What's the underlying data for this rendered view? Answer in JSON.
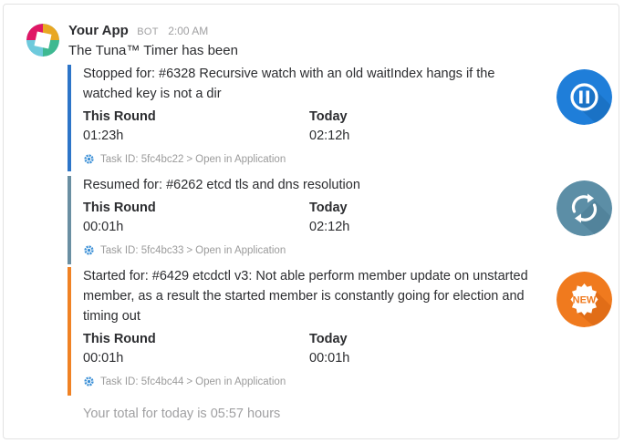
{
  "message": {
    "sender": "Your App",
    "badge": "BOT",
    "time": "2:00 AM",
    "intro": "The Tuna™ Timer has been"
  },
  "attachments": [
    {
      "text": "Stopped for: #6328 Recursive watch with an old waitIndex hangs if the watched key is not a dir",
      "color": "#2d75c8",
      "fields": [
        {
          "title": "This Round",
          "value": "01:23h"
        },
        {
          "title": "Today",
          "value": "02:12h"
        }
      ],
      "footer_task": "Task ID: 5fc4bc22",
      "footer_sep": ">",
      "footer_link": "Open in Application",
      "thumb_icon": "pause-icon"
    },
    {
      "text": "Resumed for: #6262 etcd tls and dns resolution",
      "color": "#6a8fa2",
      "fields": [
        {
          "title": "This Round",
          "value": "00:01h"
        },
        {
          "title": "Today",
          "value": "02:12h"
        }
      ],
      "footer_task": "Task ID: 5fc4bc33",
      "footer_sep": ">",
      "footer_link": "Open in Application",
      "thumb_icon": "refresh-icon"
    },
    {
      "text": "Started for: #6429 etcdctl v3: Not able perform member update on unstarted member, as a result the started member is constantly going for election and timing out",
      "color": "#f08224",
      "fields": [
        {
          "title": "This Round",
          "value": "00:01h"
        },
        {
          "title": "Today",
          "value": "00:01h"
        }
      ],
      "footer_task": "Task ID: 5fc4bc44",
      "footer_sep": ">",
      "footer_link": "Open in Application",
      "thumb_icon": "new-badge-icon",
      "thumb_label": "NEW"
    }
  ],
  "total_text": "Your total for today is 05:57 hours",
  "colors": {
    "pause": "#1f7ed9",
    "refresh": "#5c8ea6",
    "new": "#f07a1e"
  }
}
